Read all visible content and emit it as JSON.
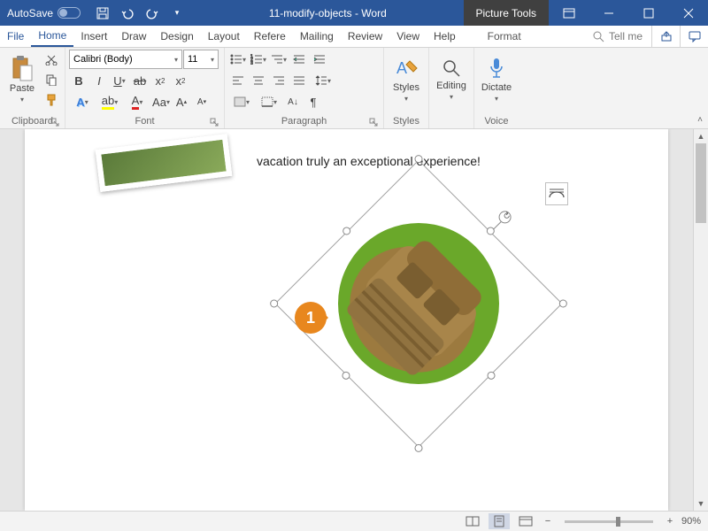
{
  "titlebar": {
    "autosave": "AutoSave",
    "title": "11-modify-objects - Word",
    "contextual": "Picture Tools"
  },
  "tabs": {
    "file": "File",
    "home": "Home",
    "insert": "Insert",
    "draw": "Draw",
    "design": "Design",
    "layout": "Layout",
    "references": "Refere",
    "mailings": "Mailing",
    "review": "Review",
    "view": "View",
    "help": "Help",
    "format": "Format",
    "tellme": "Tell me"
  },
  "ribbon": {
    "clipboard": {
      "label": "Clipboard",
      "paste": "Paste"
    },
    "font": {
      "label": "Font",
      "name": "Calibri (Body)",
      "size": "11"
    },
    "paragraph": {
      "label": "Paragraph"
    },
    "styles": {
      "label": "Styles",
      "btn": "Styles"
    },
    "editing": {
      "label": "Editing"
    },
    "voice": {
      "label": "Voice",
      "dictate": "Dictate"
    }
  },
  "document": {
    "text": "vacation truly an exceptional experience!",
    "callout": "1"
  },
  "statusbar": {
    "zoom": "90%"
  }
}
